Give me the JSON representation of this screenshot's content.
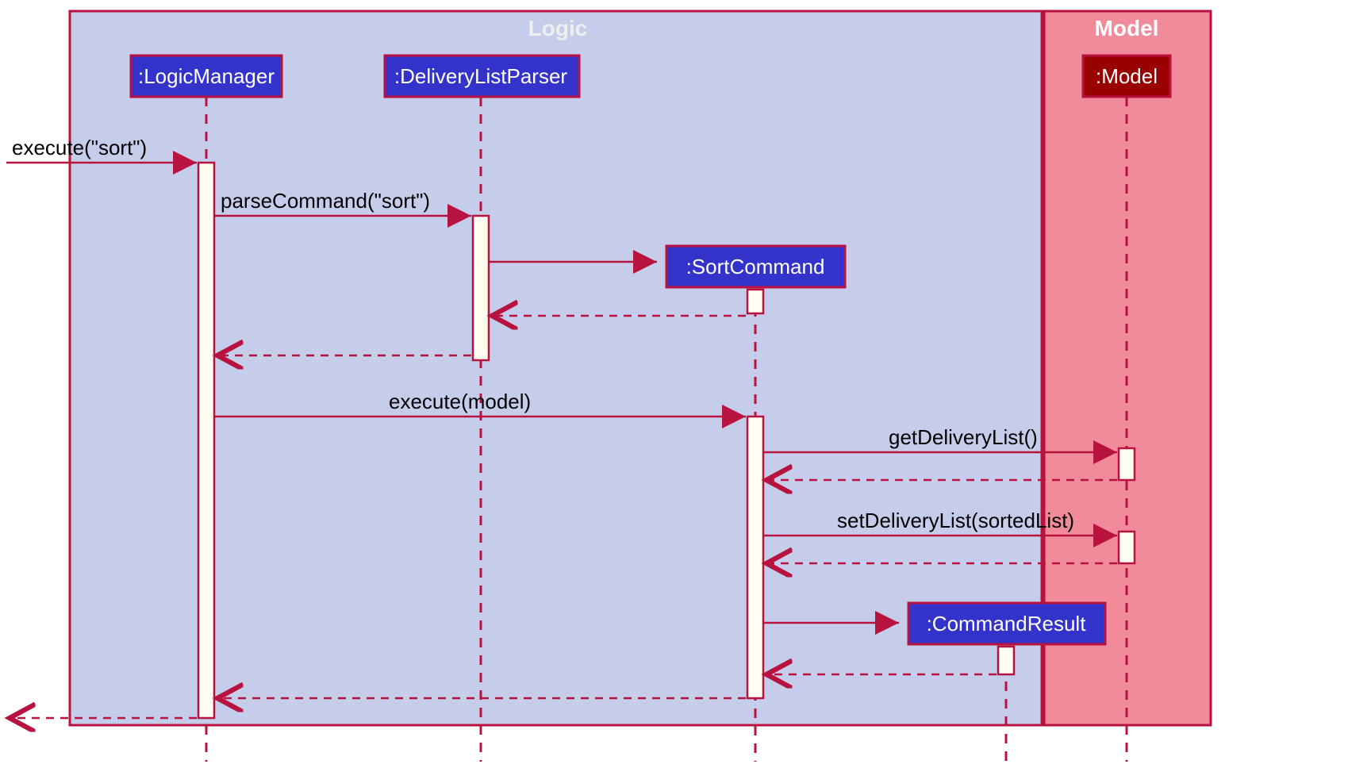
{
  "frames": {
    "logic": {
      "title": "Logic"
    },
    "model": {
      "title": "Model"
    }
  },
  "participants": {
    "logicManager": {
      "label": ":LogicManager"
    },
    "deliveryListParser": {
      "label": ":DeliveryListParser"
    },
    "sortCommand": {
      "label": ":SortCommand"
    },
    "commandResult": {
      "label": ":CommandResult"
    },
    "model": {
      "label": ":Model"
    }
  },
  "messages": {
    "executeSort": {
      "text": "execute(\"sort\")"
    },
    "parseCommand": {
      "text": "parseCommand(\"sort\")"
    },
    "executeModel": {
      "text": "execute(model)"
    },
    "getDeliveryList": {
      "text": "getDeliveryList()"
    },
    "setDeliveryList": {
      "text": "setDeliveryList(sortedList)"
    }
  }
}
